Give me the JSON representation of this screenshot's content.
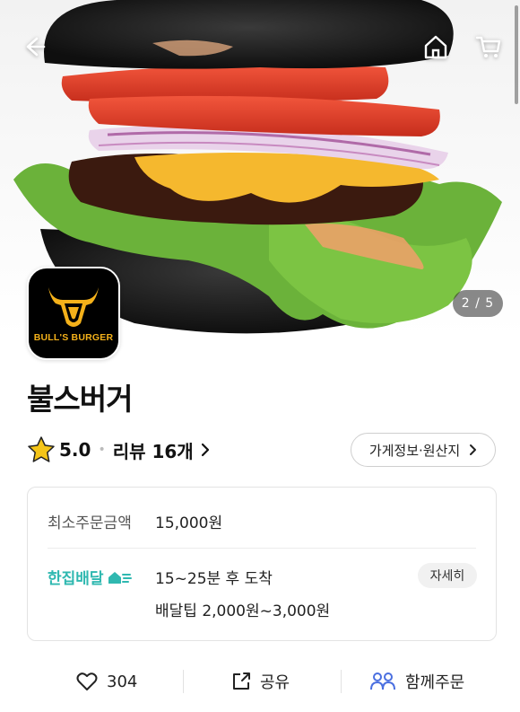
{
  "store": {
    "name": "불스버거",
    "logo_text": "BULL'S BURGER"
  },
  "hero": {
    "counter": "2 / 5",
    "icons": [
      "back-arrow-icon",
      "home-icon",
      "cart-icon"
    ]
  },
  "rating": {
    "score": "5.0",
    "review_label": "리뷰 16개"
  },
  "info_button": {
    "label": "가게정보·원산지"
  },
  "order": {
    "min_label": "최소주문금액",
    "min_value": "15,000원"
  },
  "delivery": {
    "label": "한집배달",
    "time": "15~25분 후 도착",
    "tip": "배달팁 2,000원~3,000원",
    "detail_label": "자세히"
  },
  "actions": {
    "like_count": "304",
    "share_label": "공유",
    "group_label": "함께주문"
  },
  "colors": {
    "accent_teal": "#2fb8b0",
    "group_blue": "#4a6fe0",
    "star_yellow": "#f5c518",
    "logo_gold": "#f4b11a"
  }
}
